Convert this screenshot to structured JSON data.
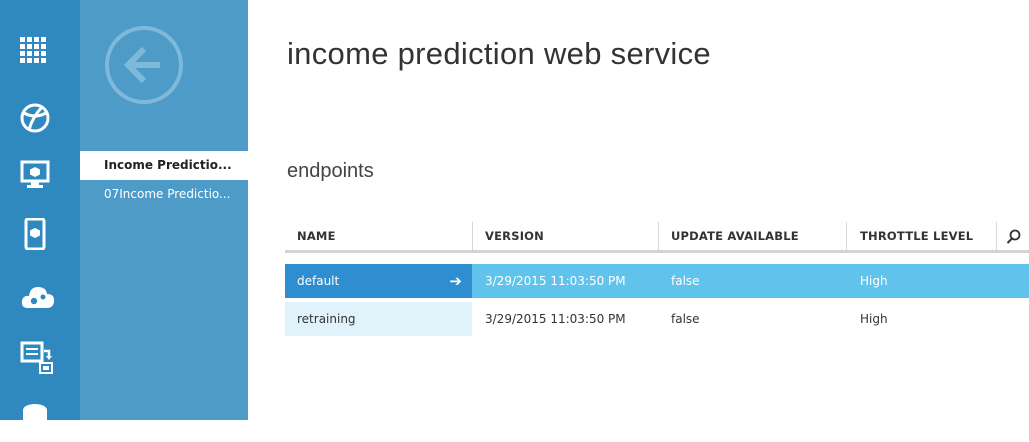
{
  "page": {
    "title": "income prediction web service"
  },
  "rail": {
    "items": [
      {
        "icon": "all-items-grid-icon"
      },
      {
        "icon": "web-sites-globe-icon"
      },
      {
        "icon": "virtual-machines-monitor-icon"
      },
      {
        "icon": "mobile-services-device-icon"
      },
      {
        "icon": "cloud-services-gears-icon"
      },
      {
        "icon": "batch-jobs-icon"
      },
      {
        "icon": "database-icon"
      }
    ]
  },
  "subnav": {
    "back_icon": "back-arrow-icon",
    "items": [
      {
        "label": "Income Predictio...",
        "selected": true
      },
      {
        "label": "07Income Predictio...",
        "selected": false
      }
    ]
  },
  "endpoints": {
    "title": "endpoints",
    "columns": [
      "NAME",
      "VERSION",
      "UPDATE AVAILABLE",
      "THROTTLE LEVEL"
    ],
    "rows": [
      {
        "name": "default",
        "version": "3/29/2015 11:03:50 PM",
        "update_available": "false",
        "throttle_level": "High",
        "selected": true
      },
      {
        "name": "retraining",
        "version": "3/29/2015 11:03:50 PM",
        "update_available": "false",
        "throttle_level": "High",
        "selected": false
      }
    ]
  },
  "colors": {
    "rail": "#2f89bf",
    "subnav": "#4e9bc7",
    "row_selected": "#5fc3ec",
    "row_selected_name": "#2e8ecf",
    "row_name_tint": "#e0f3fb"
  }
}
